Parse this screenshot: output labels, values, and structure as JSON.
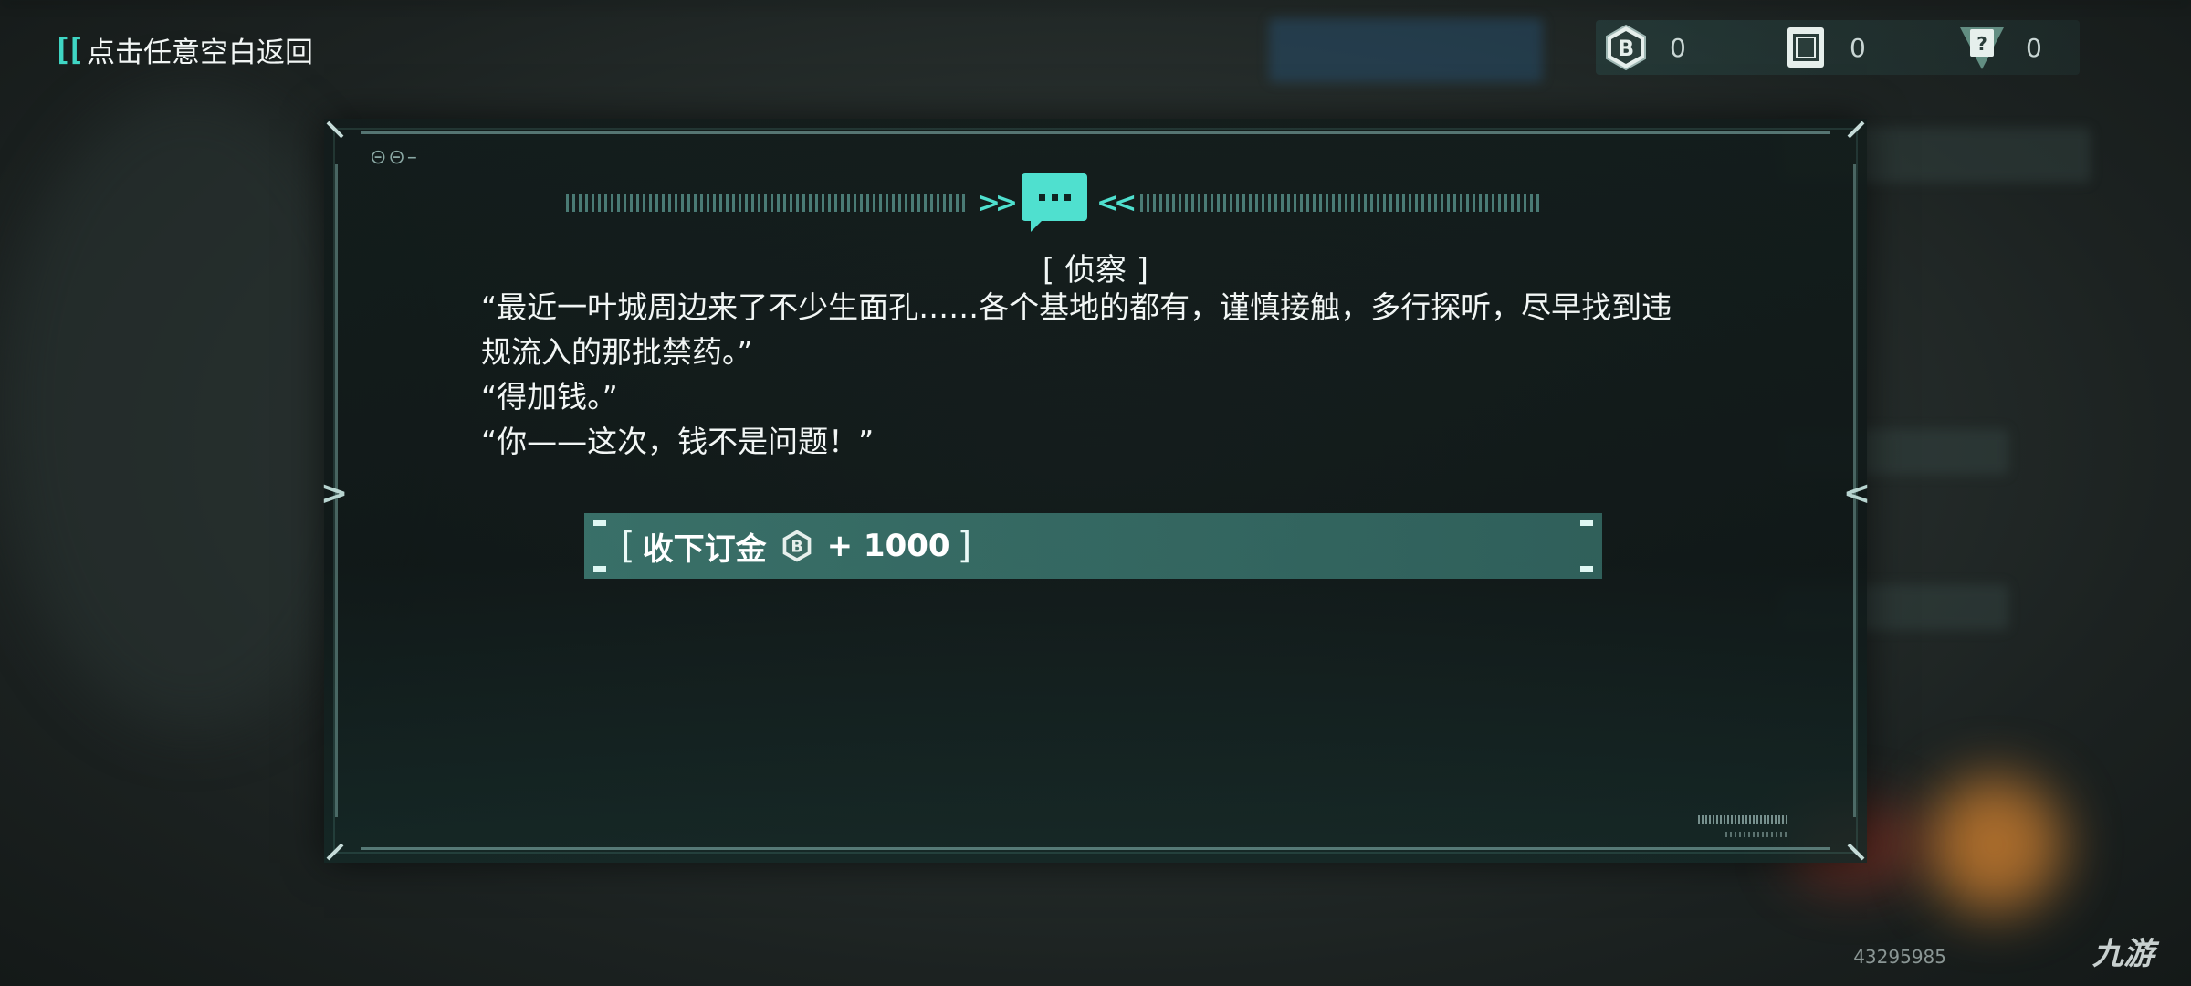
{
  "back_hint": "点击任意空白返回",
  "currencies": [
    {
      "icon": "bit-coin-icon",
      "value": "0"
    },
    {
      "icon": "chip-card-icon",
      "value": "0"
    },
    {
      "icon": "mystery-card-icon",
      "value": "0"
    }
  ],
  "dialog": {
    "title": "[ 侦察 ]",
    "lines": [
      "“最近一叶城周边来了不少生面孔……各个基地的都有，谨慎接触，多行探听，尽早找到违规流入的那批禁药。”",
      "“得加钱。”",
      "“你——这次，钱不是问题！”"
    ],
    "option": {
      "label": "收下订金",
      "amount": "+ 1000"
    }
  },
  "watermark": "43295985",
  "logo": "九游",
  "colors": {
    "accent": "#4fe0cf",
    "button": "#46948a"
  }
}
